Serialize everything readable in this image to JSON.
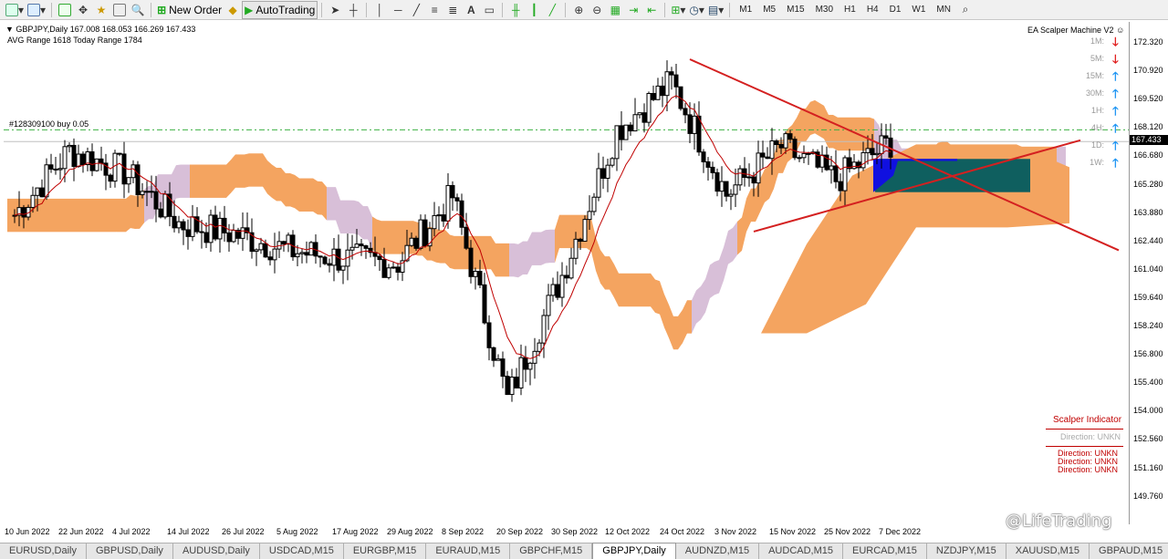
{
  "toolbar": {
    "new_order": "New Order",
    "auto_trading": "AutoTrading",
    "timeframes": [
      "M1",
      "M5",
      "M15",
      "M30",
      "H1",
      "H4",
      "D1",
      "W1",
      "MN"
    ]
  },
  "chart_info": {
    "header": "GBPJPY,Daily  167.008 168.053 166.269 167.433",
    "ranges": "AVG Range 1618   Today Range 1784",
    "order_label": "#128309100 buy 0.05",
    "ea_name": "EA Scalper Machine V2"
  },
  "mtf_panel": {
    "labels": [
      "1M:",
      "5M:",
      "15M:",
      "30M:",
      "1H:",
      "4H:",
      "1D:",
      "1W:"
    ],
    "directions": [
      "down",
      "down",
      "up",
      "up",
      "up",
      "up",
      "up",
      "up"
    ],
    "up_color": "#2196f3",
    "down_color": "#e02020"
  },
  "scalper": {
    "title": "Scalper Indicator",
    "direction_grey": "Direction: UNKN",
    "directions": [
      "Direction: UNKN",
      "Direction: UNKN",
      "Direction: UNKN"
    ],
    "color": "#c00000"
  },
  "price_axis": {
    "labels": [
      "172.320",
      "170.920",
      "169.520",
      "168.120",
      "166.680",
      "165.280",
      "163.880",
      "162.440",
      "161.040",
      "159.640",
      "158.240",
      "156.800",
      "155.400",
      "154.000",
      "152.560",
      "151.160",
      "149.760"
    ],
    "current_price": "167.433"
  },
  "date_axis": {
    "labels": [
      "10 Jun 2022",
      "22 Jun 2022",
      "4 Jul 2022",
      "14 Jul 2022",
      "26 Jul 2022",
      "5 Aug 2022",
      "17 Aug 2022",
      "29 Aug 2022",
      "8 Sep 2022",
      "20 Sep 2022",
      "30 Sep 2022",
      "12 Oct 2022",
      "24 Oct 2022",
      "3 Nov 2022",
      "15 Nov 2022",
      "25 Nov 2022",
      "7 Dec 2022"
    ]
  },
  "tabs": [
    "EURUSD,Daily",
    "GBPUSD,Daily",
    "AUDUSD,Daily",
    "USDCAD,M15",
    "EURGBP,M15",
    "EURAUD,M15",
    "GBPCHF,M15",
    "GBPJPY,Daily",
    "AUDNZD,M15",
    "AUDCAD,M15",
    "EURCAD,M15",
    "NZDJPY,M15",
    "XAUUSD,M15",
    "GBPAUD,M15"
  ],
  "active_tab": "GBPJPY,Daily",
  "watermark": "@LifeTrading",
  "chart_data": {
    "type": "candlestick",
    "title": "GBPJPY,Daily",
    "ylim": [
      149.0,
      173.2
    ],
    "x": [
      "10 Jun 2022",
      "22 Jun 2022",
      "4 Jul 2022",
      "14 Jul 2022",
      "26 Jul 2022",
      "5 Aug 2022",
      "17 Aug 2022",
      "29 Aug 2022",
      "8 Sep 2022",
      "20 Sep 2022",
      "30 Sep 2022",
      "12 Oct 2022",
      "24 Oct 2022",
      "3 Nov 2022",
      "15 Nov 2022",
      "25 Nov 2022",
      "7 Dec 2022"
    ],
    "close_approx": [
      163.9,
      167.0,
      166.0,
      163.5,
      163.0,
      162.2,
      161.8,
      161.6,
      164.8,
      155.0,
      161.0,
      168.0,
      170.3,
      164.9,
      167.2,
      165.6,
      167.4
    ],
    "current_price": 167.433,
    "order_level": 168.0,
    "colors": {
      "bull": "#000000",
      "bear": "#000000",
      "cloud_bull": "#f4a460",
      "cloud_bear": "#d8bfd8",
      "trendline": "#d42020",
      "ma": "#c00000",
      "order_line": "#3cb043",
      "box_fill": "#0f5f5f",
      "box_blue": "#1010e0"
    },
    "grid": false
  }
}
